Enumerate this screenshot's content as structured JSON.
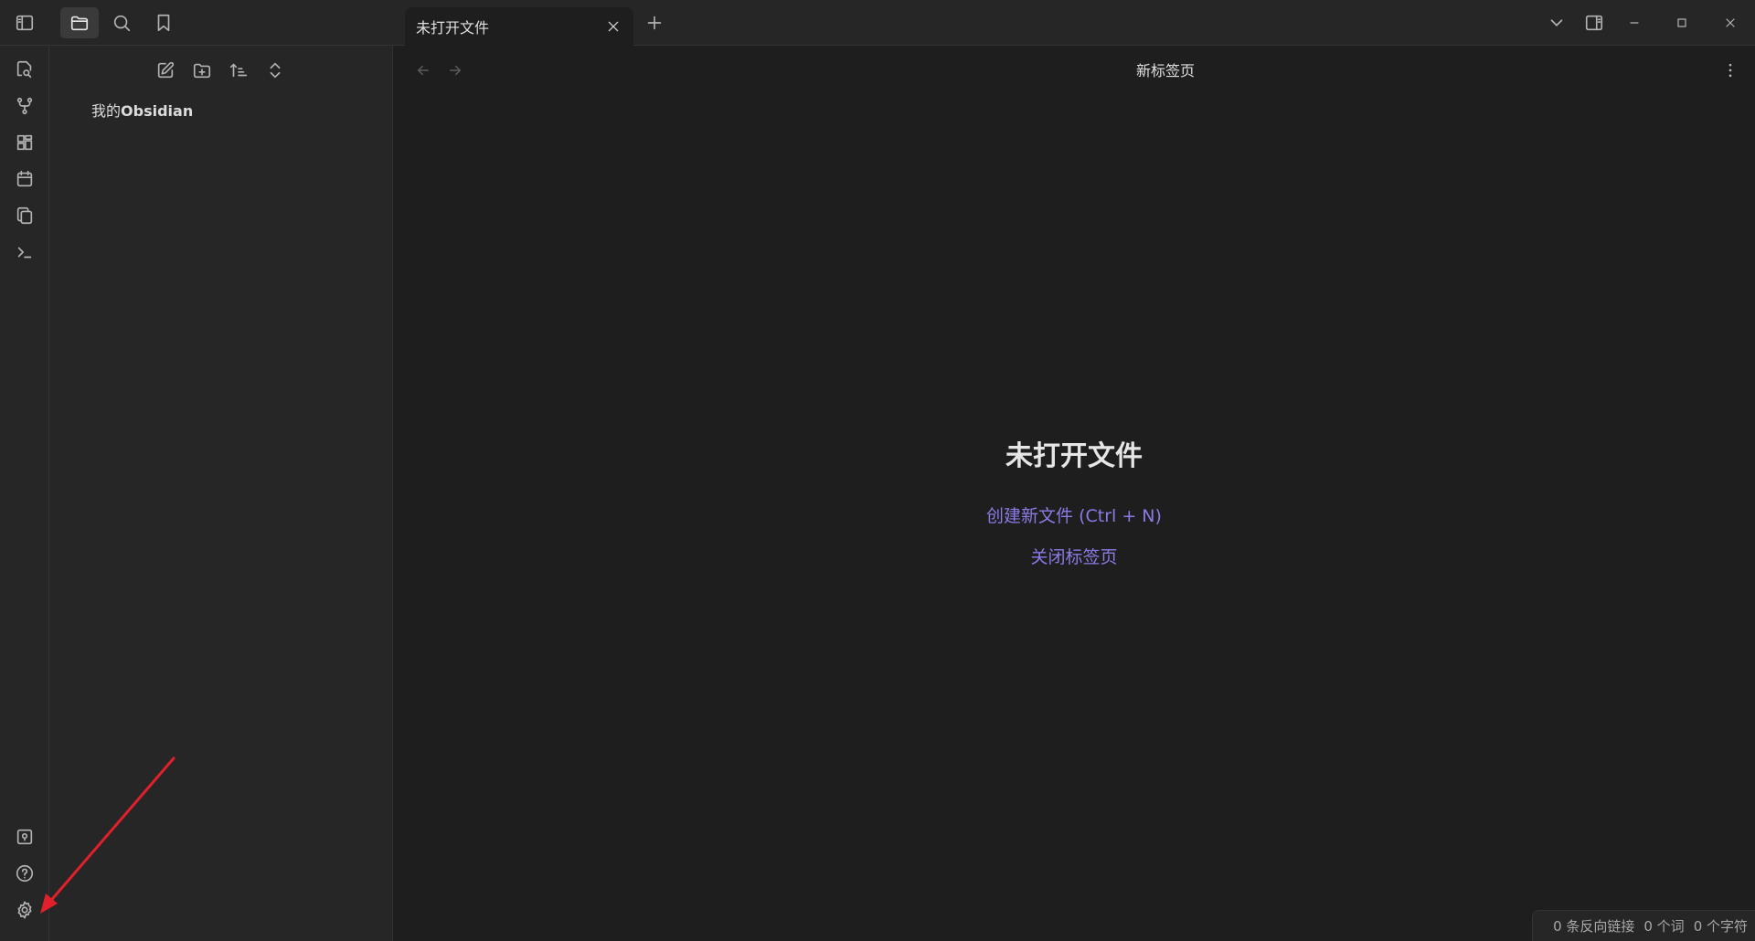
{
  "tabs": [
    {
      "title": "未打开文件"
    }
  ],
  "explorer": {
    "vault_prefix": "我的",
    "vault_name": "Obsidian"
  },
  "main": {
    "view_title": "新标签页",
    "empty_title": "未打开文件",
    "create_action": "创建新文件 (Ctrl + N)",
    "close_action": "关闭标签页"
  },
  "status": {
    "backlinks": "0 条反向链接",
    "words": "0 个词",
    "chars": "0 个字符"
  },
  "colors": {
    "accent": "#8c7ae6",
    "annotation_arrow": "#e0202a"
  }
}
